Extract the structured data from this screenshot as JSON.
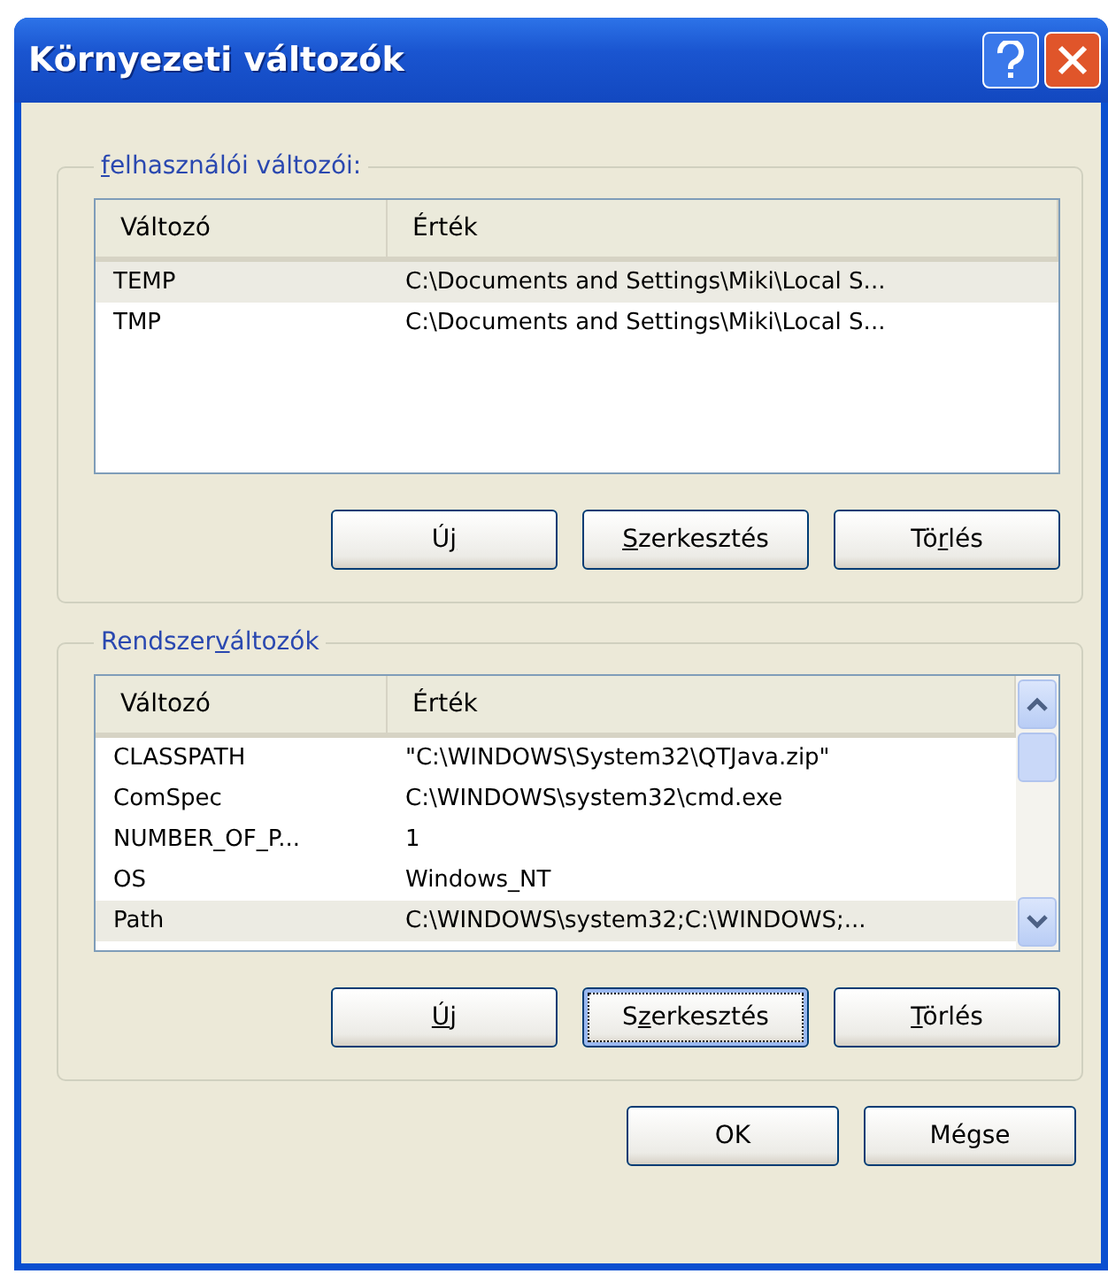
{
  "window": {
    "title": "Környezeti változók"
  },
  "groups": [
    {
      "label": {
        "key": "f",
        "post": "elhasználói változói:"
      },
      "columns": [
        "Változó",
        "Érték"
      ],
      "scrollbar": false,
      "rows": [
        {
          "name": "TEMP",
          "value": "C:\\Documents and Settings\\Miki\\Local S...",
          "selected": true
        },
        {
          "name": "TMP",
          "value": "C:\\Documents and Settings\\Miki\\Local S...",
          "selected": false
        }
      ],
      "buttons": [
        {
          "label": {
            "pre": "Ú",
            "key": "j"
          },
          "focused": false
        },
        {
          "label": {
            "key": "S",
            "post": "zerkesztés"
          },
          "focused": false
        },
        {
          "label": {
            "pre": "Tö",
            "key": "r",
            "post": "lés"
          },
          "focused": false
        }
      ]
    },
    {
      "label": {
        "pre": "Rendszer",
        "key": "v",
        "post": "áltozók"
      },
      "columns": [
        "Változó",
        "Érték"
      ],
      "scrollbar": true,
      "rows": [
        {
          "name": "CLASSPATH",
          "value": "\"C:\\WINDOWS\\System32\\QTJava.zip\"",
          "selected": false
        },
        {
          "name": "ComSpec",
          "value": "C:\\WINDOWS\\system32\\cmd.exe",
          "selected": false
        },
        {
          "name": "NUMBER_OF_P...",
          "value": "1",
          "selected": false
        },
        {
          "name": "OS",
          "value": "Windows_NT",
          "selected": false
        },
        {
          "name": "Path",
          "value": "C:\\WINDOWS\\system32;C:\\WINDOWS;...",
          "selected": true
        }
      ],
      "buttons": [
        {
          "label": {
            "key": "Ú",
            "post": "j"
          },
          "focused": false
        },
        {
          "label": {
            "pre": "S",
            "key": "z",
            "post": "erkesztés"
          },
          "focused": true
        },
        {
          "label": {
            "key": "T",
            "post": "örlés"
          },
          "focused": false
        }
      ]
    }
  ],
  "buttons": [
    {
      "label": "OK"
    },
    {
      "label": "Mégse"
    }
  ]
}
